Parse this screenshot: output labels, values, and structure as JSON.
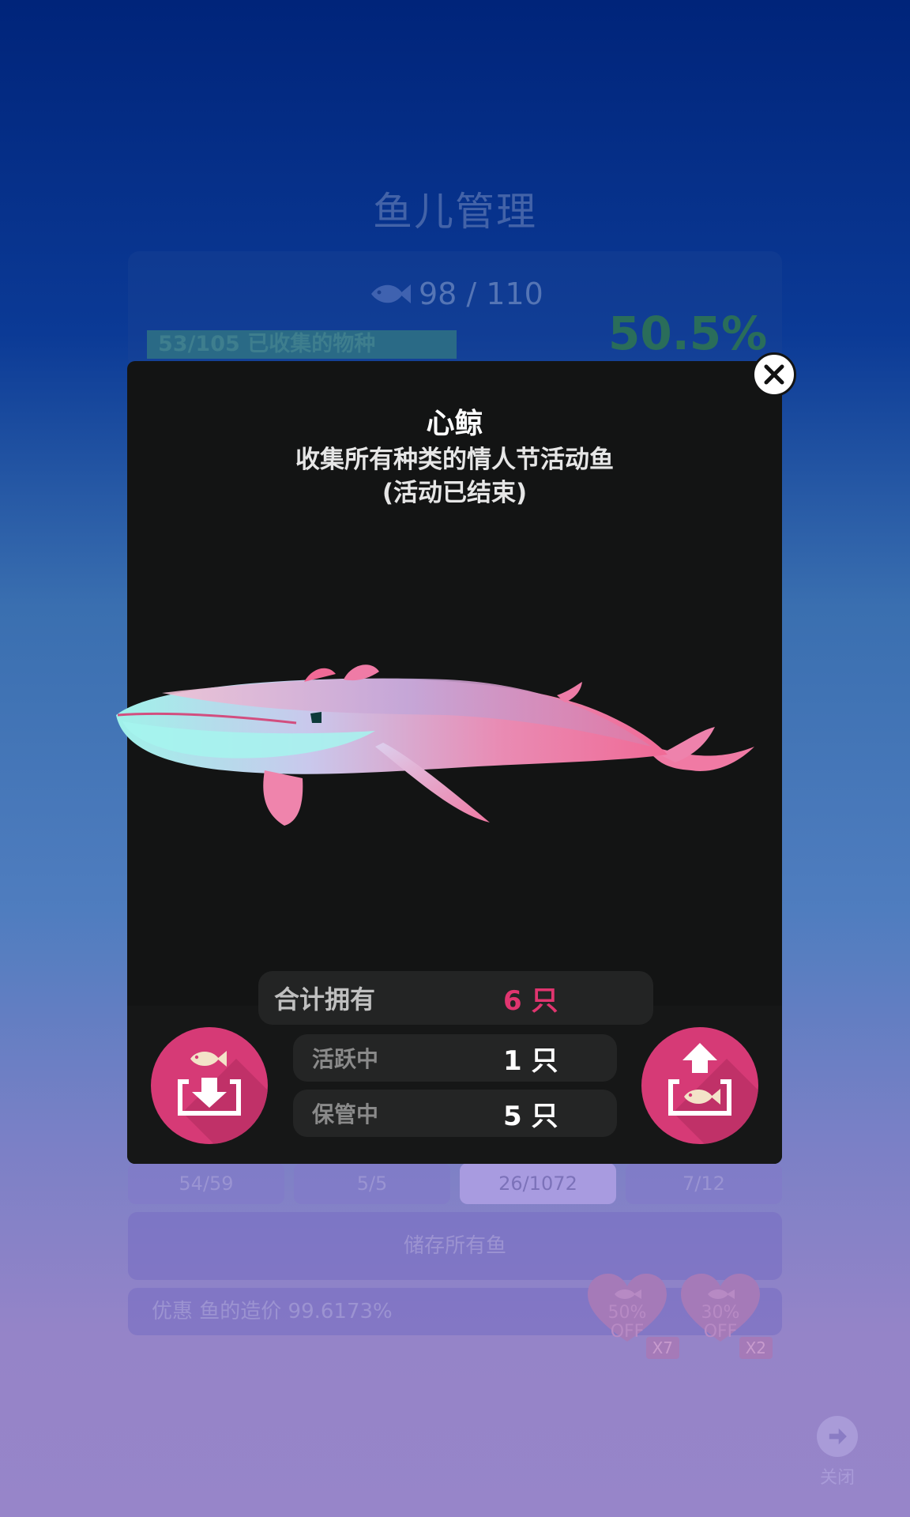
{
  "background": {
    "title": "鱼儿管理",
    "fish_count": "98 / 110",
    "species": "53/105 已收集的物种",
    "percent": "50.5%",
    "tabs": [
      "54/59",
      "5/5",
      "26/1072",
      "7/12"
    ],
    "store_all": "储存所有鱼",
    "discount": "优惠 鱼的造价 99.6173%",
    "coupons": [
      {
        "line1": "50%",
        "line2": "OFF",
        "qty": "X7"
      },
      {
        "line1": "30%",
        "line2": "OFF",
        "qty": "X2"
      }
    ],
    "close_label": "关闭"
  },
  "modal": {
    "name": "心鲸",
    "desc_line1": "收集所有种类的情人节活动鱼",
    "desc_line2": "(活动已结束)",
    "total_label": "合计拥有",
    "total_value": "6 只",
    "active_label": "活跃中",
    "active_value": "1 只",
    "stored_label": "保管中",
    "stored_value": "5 只"
  },
  "colors": {
    "accent_pink": "#d63a76",
    "total_value": "#e0356f",
    "modal_bg": "#131414"
  },
  "icons": [
    "fish-icon",
    "close-icon",
    "store-fish-icon",
    "release-fish-icon",
    "arrow-right-icon",
    "heart-coupon-icon"
  ]
}
